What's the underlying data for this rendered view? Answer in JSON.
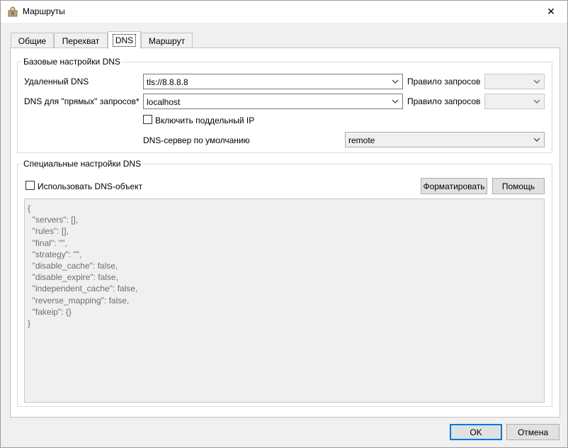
{
  "window": {
    "title": "Маршруты",
    "close_glyph": "✕"
  },
  "tabs": [
    {
      "label": "Общие"
    },
    {
      "label": "Перехват"
    },
    {
      "label": "DNS"
    },
    {
      "label": "Маршрут"
    }
  ],
  "active_tab": "DNS",
  "basic": {
    "title": "Базовые настройки DNS",
    "remote_dns_label": "Удаленный DNS",
    "remote_dns_value": "tls://8.8.8.8",
    "rule1_label": "Правило запросов",
    "rule1_value": "",
    "direct_dns_label": "DNS для \"прямых\" запросов*",
    "direct_dns_value": "localhost",
    "rule2_label": "Правило запросов",
    "rule2_value": "",
    "fake_ip_label": "Включить поддельный IP",
    "fake_ip_checked": false,
    "default_server_label": "DNS-сервер по умолчанию",
    "default_server_value": "remote"
  },
  "special": {
    "title": "Специальные настройки DNS",
    "use_object_label": "Использовать DNS-объект",
    "use_object_checked": false,
    "format_button": "Форматировать",
    "help_button": "Помощь",
    "editor_lines": [
      "{",
      "  \"servers\": [],",
      "  \"rules\": [],",
      "  \"final\": \"\",",
      "  \"strategy\": \"\",",
      "  \"disable_cache\": false,",
      "  \"disable_expire\": false,",
      "  \"independent_cache\": false,",
      "  \"reverse_mapping\": false,",
      "  \"fakeip\": {}",
      "}"
    ]
  },
  "footer": {
    "ok_button": "OK",
    "cancel_button": "Отмена"
  }
}
